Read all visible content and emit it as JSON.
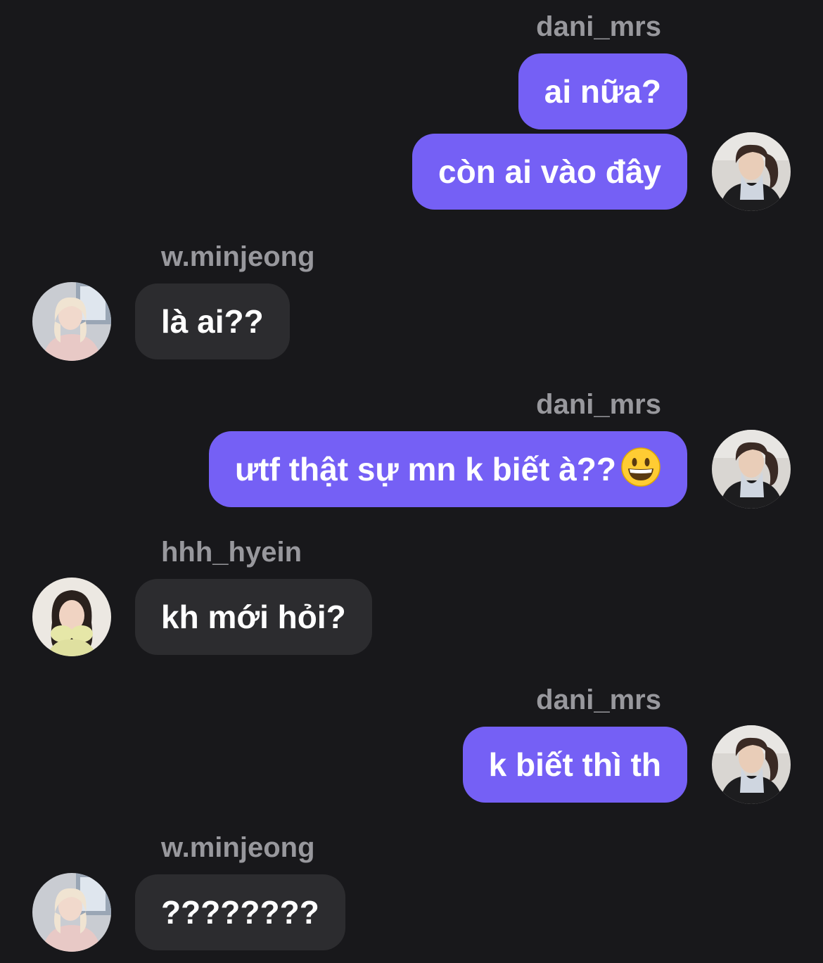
{
  "colors": {
    "background": "#18181b",
    "outgoing_bubble": "#7560f5",
    "incoming_bubble": "#2c2c2f",
    "username": "#98989d",
    "text": "#ffffff"
  },
  "messages": [
    {
      "sender": "dani_mrs",
      "direction": "outgoing",
      "text": "ai nữa?"
    },
    {
      "sender": "dani_mrs",
      "direction": "outgoing",
      "text": "còn ai vào đây"
    },
    {
      "sender": "w.minjeong",
      "direction": "incoming",
      "text": "là ai??"
    },
    {
      "sender": "dani_mrs",
      "direction": "outgoing",
      "text": "ưtf thật sự mn k biết à??",
      "emoji": "grinning-face-emoji"
    },
    {
      "sender": "hhh_hyein",
      "direction": "incoming",
      "text": "kh mới hỏi?"
    },
    {
      "sender": "dani_mrs",
      "direction": "outgoing",
      "text": "k biết thì th"
    },
    {
      "sender": "w.minjeong",
      "direction": "incoming",
      "text": "????????"
    }
  ],
  "groups": [
    {
      "username": "dani_mrs"
    },
    {
      "username": "w.minjeong"
    },
    {
      "username": "dani_mrs"
    },
    {
      "username": "hhh_hyein"
    },
    {
      "username": "dani_mrs"
    },
    {
      "username": "w.minjeong"
    }
  ]
}
